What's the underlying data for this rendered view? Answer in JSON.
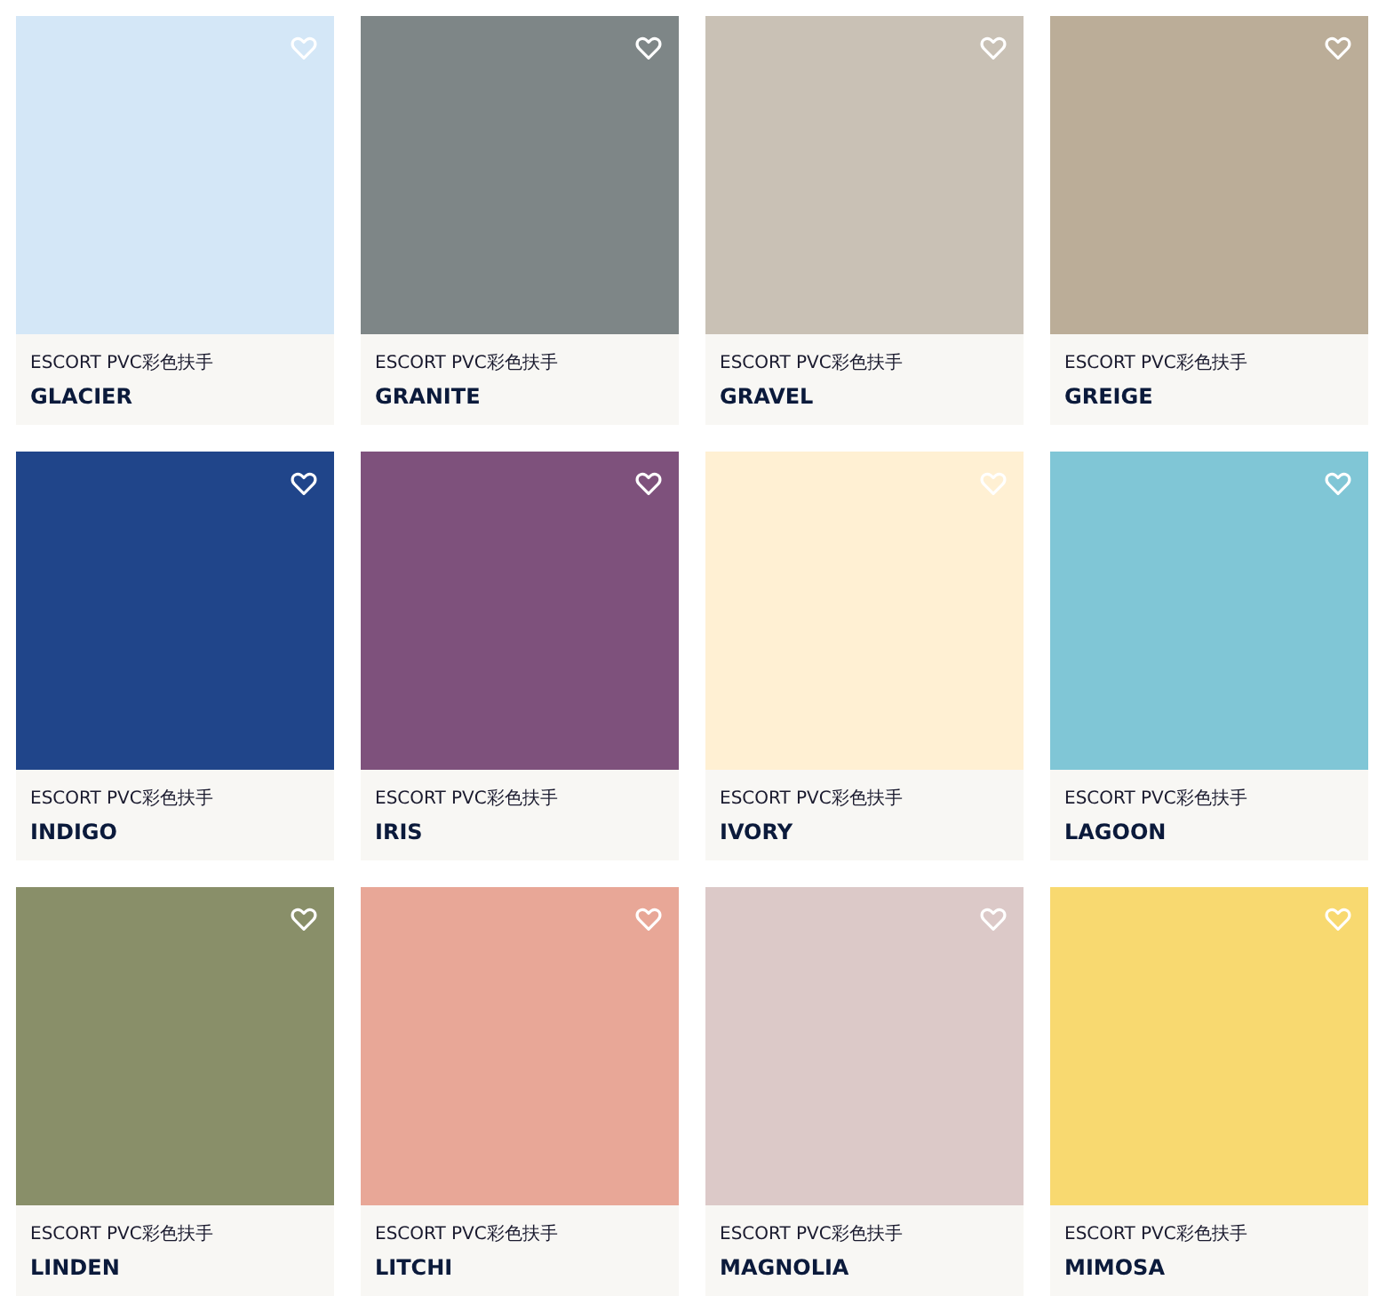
{
  "products": [
    {
      "subtitle": "ESCORT PVC彩色扶手",
      "name": "GLACIER",
      "color": "#d4e7f7"
    },
    {
      "subtitle": "ESCORT PVC彩色扶手",
      "name": "GRANITE",
      "color": "#7e8687"
    },
    {
      "subtitle": "ESCORT PVC彩色扶手",
      "name": "GRAVEL",
      "color": "#c9c1b5"
    },
    {
      "subtitle": "ESCORT PVC彩色扶手",
      "name": "GREIGE",
      "color": "#bbad98"
    },
    {
      "subtitle": "ESCORT PVC彩色扶手",
      "name": "INDIGO",
      "color": "#20458a"
    },
    {
      "subtitle": "ESCORT PVC彩色扶手",
      "name": "IRIS",
      "color": "#7e517c"
    },
    {
      "subtitle": "ESCORT PVC彩色扶手",
      "name": "IVORY",
      "color": "#fff0d3"
    },
    {
      "subtitle": "ESCORT PVC彩色扶手",
      "name": "LAGOON",
      "color": "#80c6d6"
    },
    {
      "subtitle": "ESCORT PVC彩色扶手",
      "name": "LINDEN",
      "color": "#898f69"
    },
    {
      "subtitle": "ESCORT PVC彩色扶手",
      "name": "LITCHI",
      "color": "#e8a797"
    },
    {
      "subtitle": "ESCORT PVC彩色扶手",
      "name": "MAGNOLIA",
      "color": "#dcc9c8"
    },
    {
      "subtitle": "ESCORT PVC彩色扶手",
      "name": "MIMOSA",
      "color": "#f8d970"
    }
  ]
}
